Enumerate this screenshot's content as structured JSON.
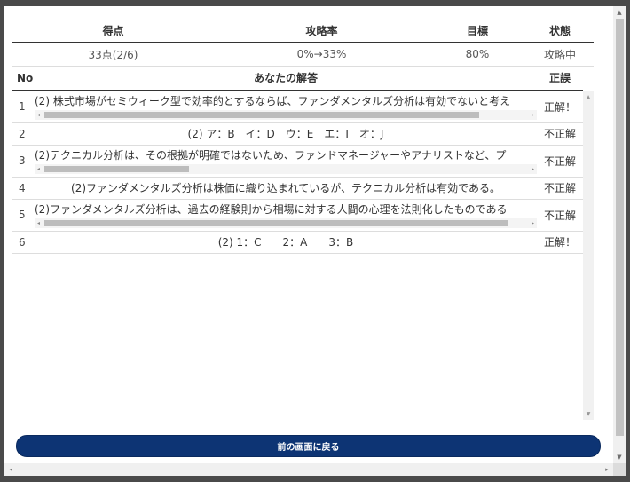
{
  "stats": {
    "headers": {
      "score": "得点",
      "rate": "攻略率",
      "target": "目標",
      "status": "状態"
    },
    "values": {
      "score": "33点(2/6)",
      "rate": "0%→33%",
      "target": "80%",
      "status": "攻略中"
    }
  },
  "answers": {
    "headers": {
      "no": "No",
      "answer": "あなたの解答",
      "result": "正誤"
    },
    "rows": [
      {
        "no": "1",
        "answer": "(2) 株式市場がセミウィーク型で効率的とするならば、ファンダメンタルズ分析は有効でないと考え",
        "result": "正解！",
        "scroll_thumb": 0.9
      },
      {
        "no": "2",
        "answer": "(2) ア：B　イ：D　ウ：E　エ：I　オ：J",
        "result": "不正解"
      },
      {
        "no": "3",
        "answer": "(2)テクニカル分析は、その根拠が明確ではないため、ファンドマネージャーやアナリストなど、プ",
        "result": "不正解",
        "scroll_thumb": 0.3
      },
      {
        "no": "4",
        "answer": "(2)ファンダメンタルズ分析は株価に織り込まれているが、テクニカル分析は有効である。",
        "result": "不正解"
      },
      {
        "no": "5",
        "answer": "(2)ファンダメンタルズ分析は、過去の経験則から相場に対する人間の心理を法則化したものである",
        "result": "不正解",
        "scroll_thumb": 0.96
      },
      {
        "no": "6",
        "answer": "(2) 1：C　　2：A　　3：B",
        "result": "正解！"
      }
    ]
  },
  "back_button": {
    "label": "前の画面に戻る"
  },
  "colors": {
    "button_bg": "#0d3474",
    "header_rule": "#333333"
  },
  "icons": {
    "up": "arrow-up-icon",
    "down": "arrow-down-icon",
    "left": "arrow-left-icon",
    "right": "arrow-right-icon"
  }
}
